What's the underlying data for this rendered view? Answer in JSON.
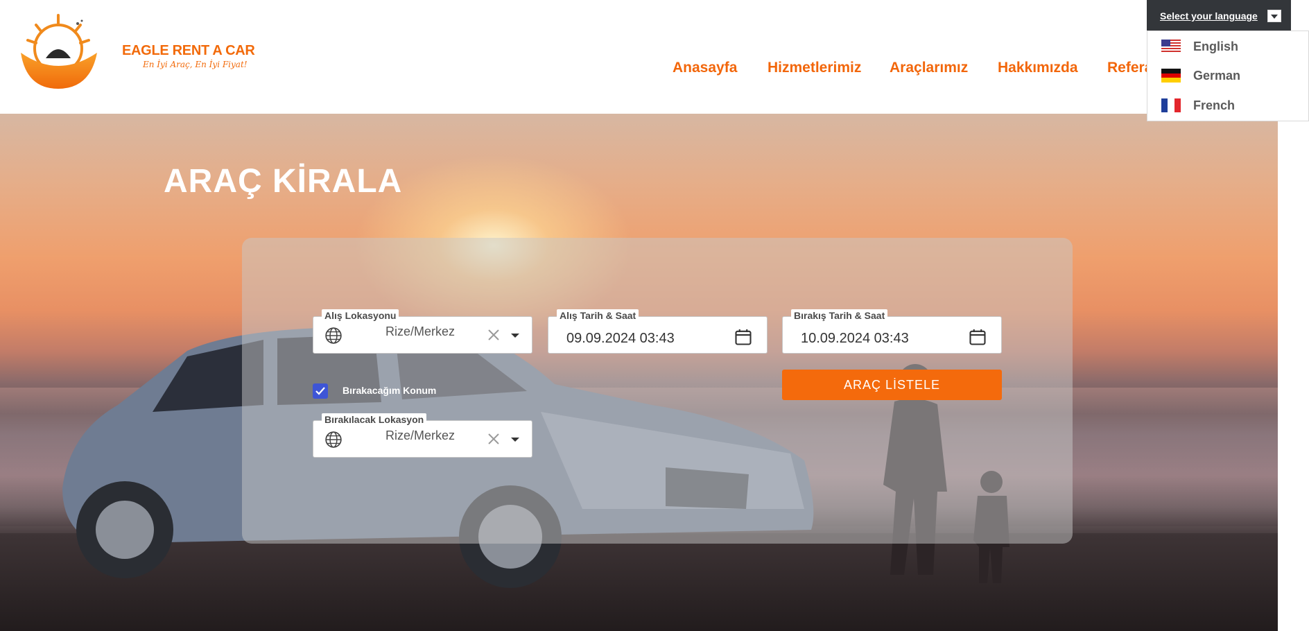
{
  "header": {
    "brand_name": "EAGLE RENT A CAR",
    "tagline": "En İyi Araç, En İyi Fiyat!",
    "nav": [
      {
        "label": "Anasayfa"
      },
      {
        "label": "Hizmetlerimiz"
      },
      {
        "label": "Araçlarımız"
      },
      {
        "label": "Hakkımızda"
      },
      {
        "label": "Referanslar"
      }
    ]
  },
  "language": {
    "button_label": "Select your language",
    "options": [
      {
        "label": "English",
        "flag": "us-flag-icon"
      },
      {
        "label": "German",
        "flag": "de-flag-icon"
      },
      {
        "label": "French",
        "flag": "fr-flag-icon"
      }
    ]
  },
  "hero": {
    "title": "ARAÇ KİRALA"
  },
  "search": {
    "pickup_location": {
      "label": "Alış Lokasyonu",
      "value": "Rize/Merkez"
    },
    "pickup_datetime": {
      "label": "Alış Tarih & Saat",
      "value": "09.09.2024 03:43"
    },
    "return_datetime": {
      "label": "Bırakış Tarih & Saat",
      "value": "10.09.2024 03:43"
    },
    "different_return": {
      "label": "Bırakacağım Konum",
      "checked": true
    },
    "return_location": {
      "label": "Bırakılacak Lokasyon",
      "value": "Rize/Merkez"
    },
    "submit_label": "ARAÇ LİSTELE"
  },
  "colors": {
    "accent": "#f46a0c",
    "checkbox": "#3e55d6",
    "language_bar": "#33363a"
  }
}
